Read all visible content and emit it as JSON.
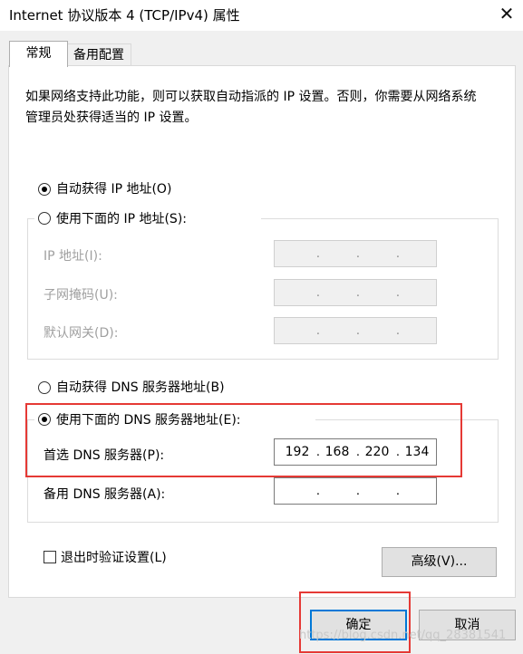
{
  "window": {
    "title": "Internet 协议版本 4 (TCP/IPv4) 属性",
    "close_glyph": "✕"
  },
  "tabs": [
    {
      "label": "常规"
    },
    {
      "label": "备用配置"
    }
  ],
  "description": "如果网络支持此功能，则可以获取自动指派的 IP 设置。否则，你需要从网络系统管理员处获得适当的 IP 设置。",
  "ip_section": {
    "auto_radio": {
      "label": "自动获得 IP 地址(O)",
      "checked": true
    },
    "manual_radio": {
      "label": "使用下面的 IP 地址(S):",
      "checked": false
    },
    "fields": [
      {
        "label": "IP 地址(I):",
        "value": ". . ."
      },
      {
        "label": "子网掩码(U):",
        "value": ". . ."
      },
      {
        "label": "默认网关(D):",
        "value": ". . ."
      }
    ]
  },
  "dns_section": {
    "auto_radio": {
      "label": "自动获得 DNS 服务器地址(B)",
      "checked": false
    },
    "manual_radio": {
      "label": "使用下面的 DNS 服务器地址(E):",
      "checked": true
    },
    "preferred": {
      "label": "首选 DNS 服务器(P):",
      "octets": [
        "192",
        "168",
        "220",
        "134"
      ]
    },
    "alternate": {
      "label": "备用 DNS 服务器(A):",
      "octets": [
        "",
        "",
        "",
        ""
      ]
    }
  },
  "validate_checkbox": {
    "label": "退出时验证设置(L)",
    "checked": false
  },
  "advanced_button": {
    "label": "高级(V)..."
  },
  "ok_button": {
    "label": "确定"
  },
  "cancel_button": {
    "label": "取消"
  },
  "watermark": "https://blog.csdn.net/qq_28381541",
  "colors": {
    "highlight": "#e53935",
    "accent": "#0078d7"
  }
}
